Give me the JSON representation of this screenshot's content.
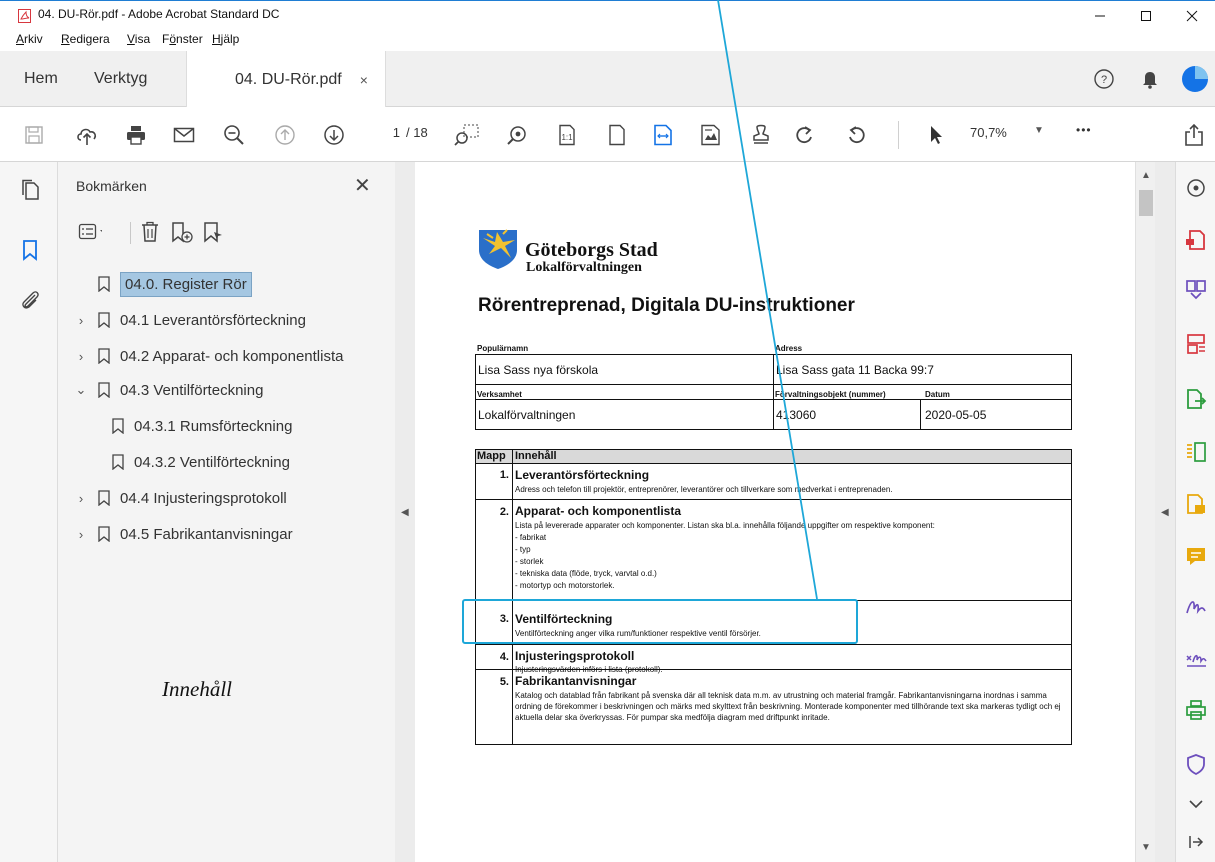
{
  "window": {
    "title": "04. DU-Rör.pdf - Adobe Acrobat Standard DC"
  },
  "menu": [
    {
      "label": "Arkiv",
      "accel": "A"
    },
    {
      "label": "Redigera",
      "accel": "R"
    },
    {
      "label": "Visa",
      "accel": "V"
    },
    {
      "label": "Fönster",
      "accel": "ö"
    },
    {
      "label": "Hjälp",
      "accel": "H"
    }
  ],
  "tabs": {
    "home": "Hem",
    "tools": "Verktyg",
    "document": "04. DU-Rör.pdf",
    "close_glyph": "×"
  },
  "toolbar": {
    "page_current": "1",
    "page_total": "/ 18",
    "zoom": "70,7%",
    "more": "•••"
  },
  "bookmarks": {
    "title": "Bokmärken",
    "close_glyph": "✕",
    "items": [
      {
        "label": "04.0. Register Rör",
        "level": 0,
        "expander": "",
        "selected": true
      },
      {
        "label": "04.1 Leverantörsförteckning",
        "level": 0,
        "expander": "›",
        "selected": false
      },
      {
        "label": "04.2 Apparat- och komponentlista",
        "level": 0,
        "expander": "›",
        "selected": false
      },
      {
        "label": "04.3 Ventilförteckning",
        "level": 0,
        "expander": "⌄",
        "selected": false
      },
      {
        "label": "04.3.1 Rumsförteckning",
        "level": 1,
        "expander": "",
        "selected": false
      },
      {
        "label": "04.3.2 Ventilförteckning",
        "level": 1,
        "expander": "",
        "selected": false
      },
      {
        "label": "04.4 Injusteringsprotokoll",
        "level": 0,
        "expander": "›",
        "selected": false
      },
      {
        "label": "04.5 Fabrikantanvisningar",
        "level": 0,
        "expander": "›",
        "selected": false
      }
    ],
    "annotation": "Innehåll"
  },
  "document": {
    "org_name": "Göteborgs Stad",
    "org_sub": "Lokalförvaltningen",
    "heading": "Rörentreprenad, Digitala DU-instruktioner",
    "info": {
      "popularnamn_label": "Populärnamn",
      "popularnamn": "Lisa Sass nya förskola",
      "adress_label": "Adress",
      "adress": "Lisa Sass gata 11 Backa 99:7",
      "verksamhet_label": "Verksamhet",
      "verksamhet": "Lokalförvaltningen",
      "objekt_label": "Förvaltningsobjekt (nummer)",
      "objekt": "413060",
      "datum_label": "Datum",
      "datum": "2020-05-05"
    },
    "contents_header": {
      "mapp": "Mapp",
      "innehall": "Innehåll"
    },
    "rows": [
      {
        "num": "1.",
        "title": "Leverantörsförteckning",
        "desc": "Adress och telefon till projektör, entreprenörer, leverantörer och tillverkare som medverkat i entreprenaden."
      },
      {
        "num": "2.",
        "title": "Apparat- och komponentlista",
        "desc": "Lista på levererade apparater och komponenter. Listan ska bl.a. innehålla följande uppgifter om respektive komponent:",
        "bullets": [
          "- fabrikat",
          "- typ",
          "- storlek",
          "- tekniska data (flöde, tryck, varvtal o.d.)",
          "- motortyp och motorstorlek."
        ]
      },
      {
        "num": "3.",
        "title": "Ventilförteckning",
        "desc": "Ventilförteckning anger vilka rum/funktioner respektive ventil försörjer."
      },
      {
        "num": "4.",
        "title": "Injusteringsprotokoll",
        "desc": "Injusteringsvärden införs i lista (protokoll)."
      },
      {
        "num": "5.",
        "title": "Fabrikantanvisningar",
        "desc": "Katalog och datablad från fabrikant på svenska där all teknisk data m.m. av utrustning och material framgår. Fabrikantanvisningarna inordnas i samma ordning de förekommer i beskrivningen och märks med skylttext från beskrivning. Monterade komponenter med tillhörande text ska markeras tydligt och ej aktuella delar ska överkryssas. För pumpar ska medfölja diagram med driftpunkt inritade."
      }
    ]
  },
  "colors": {
    "accent": "#1ea7d8",
    "selection": "#a5c7e2",
    "tool_red": "#d7373f",
    "tool_purple": "#6d4fbd",
    "tool_green": "#2d9d3f",
    "tool_yellow": "#e8a90d",
    "link_blue": "#1473e6"
  }
}
